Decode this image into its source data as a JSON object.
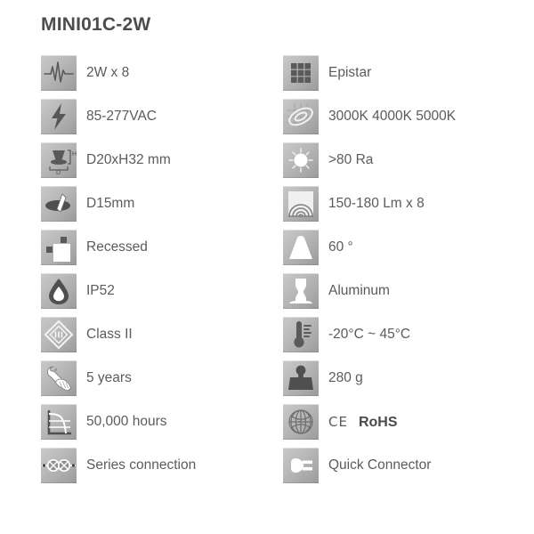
{
  "header": {
    "title": "MINI01C-2W"
  },
  "colors": {
    "text": "#5b5b5b",
    "title": "#4d4d4d",
    "icon_tile_light": "#c9c9c9",
    "icon_tile_dark": "#9a9a9a",
    "background": "#ffffff"
  },
  "spec_columns": {
    "left": [
      {
        "icon": "waveform-power-icon",
        "label": "2W x 8"
      },
      {
        "icon": "lightning-bolt-icon",
        "label": "85-277VAC"
      },
      {
        "icon": "dimension-diagram-icon",
        "label": "D20xH32 mm"
      },
      {
        "icon": "cutout-hole-icon",
        "label": "D15mm"
      },
      {
        "icon": "recessed-mount-icon",
        "label": "Recessed"
      },
      {
        "icon": "water-drop-icon",
        "label": "IP52"
      },
      {
        "icon": "class-two-diamond-icon",
        "label": "Class II"
      },
      {
        "icon": "hand-wrench-warranty-icon",
        "label": "5 years"
      },
      {
        "icon": "lifetime-curve-chart-icon",
        "label": "50,000 hours"
      },
      {
        "icon": "series-connection-icon",
        "label": "Series connection"
      }
    ],
    "right": [
      {
        "icon": "led-chip-grid-icon",
        "label": "Epistar"
      },
      {
        "icon": "color-temperature-icon",
        "label": "3000K 4000K 5000K"
      },
      {
        "icon": "sun-cri-icon",
        "label": ">80 Ra"
      },
      {
        "icon": "luminous-flux-icon",
        "label": "150-180 Lm x 8"
      },
      {
        "icon": "beam-angle-icon",
        "label": "60 °"
      },
      {
        "icon": "aluminum-body-icon",
        "label": "Aluminum"
      },
      {
        "icon": "thermometer-icon",
        "label": "-20°C ~ 45°C"
      },
      {
        "icon": "weight-icon",
        "label": "280 g"
      },
      {
        "icon": "globe-certification-icon",
        "label": "",
        "cert": {
          "ce": "CE",
          "rohs": "RoHS"
        }
      },
      {
        "icon": "quick-connector-plug-icon",
        "label": "Quick Connector"
      }
    ]
  }
}
